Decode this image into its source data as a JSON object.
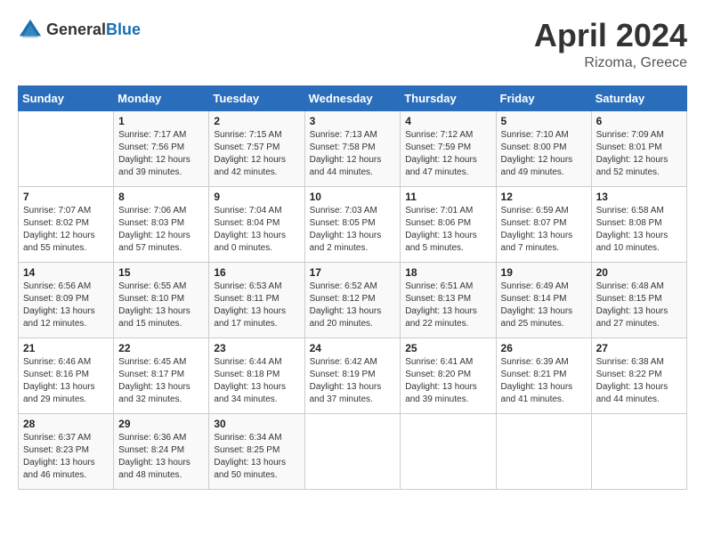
{
  "header": {
    "logo_general": "General",
    "logo_blue": "Blue",
    "title": "April 2024",
    "subtitle": "Rizoma, Greece"
  },
  "days_of_week": [
    "Sunday",
    "Monday",
    "Tuesday",
    "Wednesday",
    "Thursday",
    "Friday",
    "Saturday"
  ],
  "weeks": [
    [
      {
        "day": "",
        "sunrise": "",
        "sunset": "",
        "daylight": ""
      },
      {
        "day": "1",
        "sunrise": "Sunrise: 7:17 AM",
        "sunset": "Sunset: 7:56 PM",
        "daylight": "Daylight: 12 hours and 39 minutes."
      },
      {
        "day": "2",
        "sunrise": "Sunrise: 7:15 AM",
        "sunset": "Sunset: 7:57 PM",
        "daylight": "Daylight: 12 hours and 42 minutes."
      },
      {
        "day": "3",
        "sunrise": "Sunrise: 7:13 AM",
        "sunset": "Sunset: 7:58 PM",
        "daylight": "Daylight: 12 hours and 44 minutes."
      },
      {
        "day": "4",
        "sunrise": "Sunrise: 7:12 AM",
        "sunset": "Sunset: 7:59 PM",
        "daylight": "Daylight: 12 hours and 47 minutes."
      },
      {
        "day": "5",
        "sunrise": "Sunrise: 7:10 AM",
        "sunset": "Sunset: 8:00 PM",
        "daylight": "Daylight: 12 hours and 49 minutes."
      },
      {
        "day": "6",
        "sunrise": "Sunrise: 7:09 AM",
        "sunset": "Sunset: 8:01 PM",
        "daylight": "Daylight: 12 hours and 52 minutes."
      }
    ],
    [
      {
        "day": "7",
        "sunrise": "Sunrise: 7:07 AM",
        "sunset": "Sunset: 8:02 PM",
        "daylight": "Daylight: 12 hours and 55 minutes."
      },
      {
        "day": "8",
        "sunrise": "Sunrise: 7:06 AM",
        "sunset": "Sunset: 8:03 PM",
        "daylight": "Daylight: 12 hours and 57 minutes."
      },
      {
        "day": "9",
        "sunrise": "Sunrise: 7:04 AM",
        "sunset": "Sunset: 8:04 PM",
        "daylight": "Daylight: 13 hours and 0 minutes."
      },
      {
        "day": "10",
        "sunrise": "Sunrise: 7:03 AM",
        "sunset": "Sunset: 8:05 PM",
        "daylight": "Daylight: 13 hours and 2 minutes."
      },
      {
        "day": "11",
        "sunrise": "Sunrise: 7:01 AM",
        "sunset": "Sunset: 8:06 PM",
        "daylight": "Daylight: 13 hours and 5 minutes."
      },
      {
        "day": "12",
        "sunrise": "Sunrise: 6:59 AM",
        "sunset": "Sunset: 8:07 PM",
        "daylight": "Daylight: 13 hours and 7 minutes."
      },
      {
        "day": "13",
        "sunrise": "Sunrise: 6:58 AM",
        "sunset": "Sunset: 8:08 PM",
        "daylight": "Daylight: 13 hours and 10 minutes."
      }
    ],
    [
      {
        "day": "14",
        "sunrise": "Sunrise: 6:56 AM",
        "sunset": "Sunset: 8:09 PM",
        "daylight": "Daylight: 13 hours and 12 minutes."
      },
      {
        "day": "15",
        "sunrise": "Sunrise: 6:55 AM",
        "sunset": "Sunset: 8:10 PM",
        "daylight": "Daylight: 13 hours and 15 minutes."
      },
      {
        "day": "16",
        "sunrise": "Sunrise: 6:53 AM",
        "sunset": "Sunset: 8:11 PM",
        "daylight": "Daylight: 13 hours and 17 minutes."
      },
      {
        "day": "17",
        "sunrise": "Sunrise: 6:52 AM",
        "sunset": "Sunset: 8:12 PM",
        "daylight": "Daylight: 13 hours and 20 minutes."
      },
      {
        "day": "18",
        "sunrise": "Sunrise: 6:51 AM",
        "sunset": "Sunset: 8:13 PM",
        "daylight": "Daylight: 13 hours and 22 minutes."
      },
      {
        "day": "19",
        "sunrise": "Sunrise: 6:49 AM",
        "sunset": "Sunset: 8:14 PM",
        "daylight": "Daylight: 13 hours and 25 minutes."
      },
      {
        "day": "20",
        "sunrise": "Sunrise: 6:48 AM",
        "sunset": "Sunset: 8:15 PM",
        "daylight": "Daylight: 13 hours and 27 minutes."
      }
    ],
    [
      {
        "day": "21",
        "sunrise": "Sunrise: 6:46 AM",
        "sunset": "Sunset: 8:16 PM",
        "daylight": "Daylight: 13 hours and 29 minutes."
      },
      {
        "day": "22",
        "sunrise": "Sunrise: 6:45 AM",
        "sunset": "Sunset: 8:17 PM",
        "daylight": "Daylight: 13 hours and 32 minutes."
      },
      {
        "day": "23",
        "sunrise": "Sunrise: 6:44 AM",
        "sunset": "Sunset: 8:18 PM",
        "daylight": "Daylight: 13 hours and 34 minutes."
      },
      {
        "day": "24",
        "sunrise": "Sunrise: 6:42 AM",
        "sunset": "Sunset: 8:19 PM",
        "daylight": "Daylight: 13 hours and 37 minutes."
      },
      {
        "day": "25",
        "sunrise": "Sunrise: 6:41 AM",
        "sunset": "Sunset: 8:20 PM",
        "daylight": "Daylight: 13 hours and 39 minutes."
      },
      {
        "day": "26",
        "sunrise": "Sunrise: 6:39 AM",
        "sunset": "Sunset: 8:21 PM",
        "daylight": "Daylight: 13 hours and 41 minutes."
      },
      {
        "day": "27",
        "sunrise": "Sunrise: 6:38 AM",
        "sunset": "Sunset: 8:22 PM",
        "daylight": "Daylight: 13 hours and 44 minutes."
      }
    ],
    [
      {
        "day": "28",
        "sunrise": "Sunrise: 6:37 AM",
        "sunset": "Sunset: 8:23 PM",
        "daylight": "Daylight: 13 hours and 46 minutes."
      },
      {
        "day": "29",
        "sunrise": "Sunrise: 6:36 AM",
        "sunset": "Sunset: 8:24 PM",
        "daylight": "Daylight: 13 hours and 48 minutes."
      },
      {
        "day": "30",
        "sunrise": "Sunrise: 6:34 AM",
        "sunset": "Sunset: 8:25 PM",
        "daylight": "Daylight: 13 hours and 50 minutes."
      },
      {
        "day": "",
        "sunrise": "",
        "sunset": "",
        "daylight": ""
      },
      {
        "day": "",
        "sunrise": "",
        "sunset": "",
        "daylight": ""
      },
      {
        "day": "",
        "sunrise": "",
        "sunset": "",
        "daylight": ""
      },
      {
        "day": "",
        "sunrise": "",
        "sunset": "",
        "daylight": ""
      }
    ]
  ]
}
